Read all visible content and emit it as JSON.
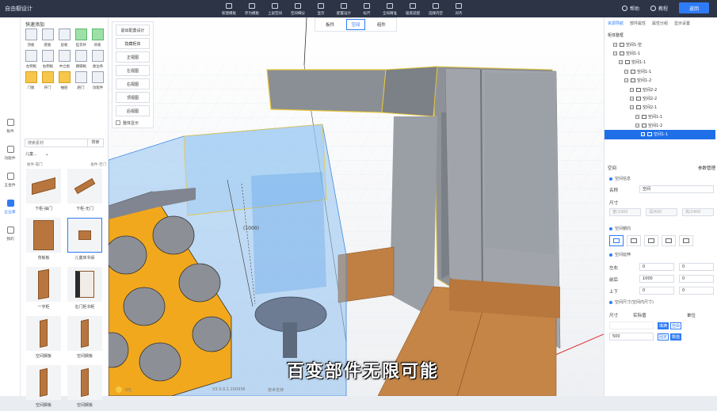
{
  "app": {
    "title": "自由橱设计"
  },
  "toolbar": {
    "tools": [
      "新建模板",
      "存为模板",
      "上层空间",
      "空间细分",
      "显示",
      "配置设计",
      "标尺",
      "全局精准",
      "吸底适配",
      "选择内空",
      "对齐"
    ]
  },
  "topright": {
    "help": "帮助",
    "tutorial": "教程",
    "return_label": "返回"
  },
  "leftnav": [
    {
      "label": "板件",
      "icon": "panel-icon"
    },
    {
      "label": "功能件",
      "icon": "function-icon"
    },
    {
      "label": "五金件",
      "icon": "hardware-icon"
    },
    {
      "label": "企业库",
      "icon": "library-icon",
      "active": true
    },
    {
      "label": "我的",
      "icon": "user-icon"
    }
  ],
  "panel": {
    "title": "快速添加",
    "quick_items": [
      {
        "label": "顶板",
        "style": "plain"
      },
      {
        "label": "底板",
        "style": "plain"
      },
      {
        "label": "层板",
        "style": "plain"
      },
      {
        "label": "挂衣杆",
        "style": "green"
      },
      {
        "label": "背板",
        "style": "green"
      },
      {
        "label": "左侧板",
        "style": "plain"
      },
      {
        "label": "右侧板",
        "style": "plain"
      },
      {
        "label": "中立板",
        "style": "plain"
      },
      {
        "label": "踢脚板",
        "style": "plain"
      },
      {
        "label": "收边条",
        "style": "plain"
      },
      {
        "label": "门板",
        "style": "yellow"
      },
      {
        "label": "开门",
        "style": "yellow"
      },
      {
        "label": "抽屉",
        "style": "yellow"
      },
      {
        "label": "趟门",
        "style": "plain"
      },
      {
        "label": "功能件",
        "style": "plain"
      }
    ],
    "search_placeholder": "搜索素材",
    "search_button": "搜索",
    "category": "儿童...",
    "category_row": [
      "板件-靠门",
      "板件-无门"
    ],
    "items": [
      {
        "label": "下柜-抽门",
        "selected": false
      },
      {
        "label": "下柜-无门",
        "selected": false
      },
      {
        "label": "背板板",
        "selected": false
      },
      {
        "label": "儿童床书桌",
        "selected": true
      },
      {
        "label": "一字柜",
        "selected": false
      },
      {
        "label": "右门柜书柜",
        "selected": false
      },
      {
        "label": "空间搁板",
        "selected": false
      },
      {
        "label": "空间搁板",
        "selected": false
      },
      {
        "label": "空间搁板",
        "selected": false
      },
      {
        "label": "空间搁板",
        "selected": false
      }
    ]
  },
  "vtool": {
    "buttons": [
      "退出配置设计",
      "隐藏柜体",
      "正视图",
      "左视图",
      "右视图",
      "顶视图",
      "后视图"
    ],
    "checkbox_label": "整体显示"
  },
  "viewport": {
    "tabs": [
      "板件",
      "空间",
      "组件"
    ],
    "active_tab": "空间",
    "dimension_label": "(1000)",
    "subtitle": "百变部件无限可能",
    "version": "V3.5.0.1.100936",
    "tech": "技术支持",
    "coin_label": "0元"
  },
  "rpanel": {
    "tabs": [
      "资源导航",
      "部件属性",
      "属性分组",
      "显示设置"
    ],
    "active_tab": "资源导航",
    "tree": [
      {
        "label": "柜体整框",
        "indent": 0
      },
      {
        "label": "空间1-空",
        "indent": 1
      },
      {
        "label": "空间1-1",
        "indent": 1
      },
      {
        "label": "空间1-1",
        "indent": 2
      },
      {
        "label": "空间1-1",
        "indent": 3
      },
      {
        "label": "空间1-2",
        "indent": 3
      },
      {
        "label": "空间2-2",
        "indent": 4
      },
      {
        "label": "空间2-2",
        "indent": 4
      },
      {
        "label": "空间2-1",
        "indent": 4
      },
      {
        "label": "空间1-1",
        "indent": 5
      },
      {
        "label": "空间1-2",
        "indent": 5
      },
      {
        "label": "空间1-1",
        "indent": 6,
        "selected": true
      }
    ],
    "props": {
      "title": "空间",
      "link": "参数管理",
      "section1": "空间信息",
      "name_label": "名称",
      "name_value": "空间",
      "size_label": "尺寸",
      "dims": [
        "宽/1000",
        "深/600",
        "高/2400"
      ],
      "section2": "空间朝向",
      "section3": "空间延伸",
      "rows": [
        {
          "label": "左右",
          "a": "0",
          "b": "0"
        },
        {
          "label": "前后",
          "a": "1000",
          "b": "0"
        },
        {
          "label": "上下",
          "a": "0",
          "b": "0"
        }
      ],
      "section4": "空间尺寸(空间内尺寸)",
      "col_size": "尺寸",
      "col_actual": "实际值",
      "col_unit": "单位",
      "row1_value": "",
      "row2_value": "500",
      "btn_fill": "填满",
      "btn_auto": "自由",
      "btn_fixed": "固定",
      "btn_value": "数值"
    }
  },
  "colors": {
    "accent": "#2f7bf5",
    "topbar": "#2c3446",
    "wood": "#b8763e",
    "grey_panel": "#7b7f86",
    "yellow": "#f2a81d"
  }
}
